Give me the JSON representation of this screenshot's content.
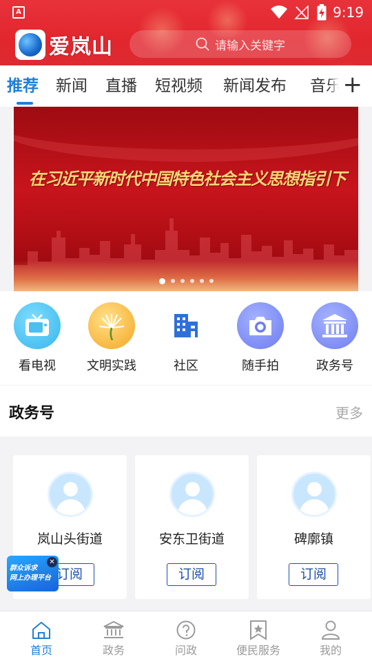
{
  "status_bar": {
    "time": "9:19",
    "app_icon": "A"
  },
  "header": {
    "app_name": "爱岚山",
    "search_placeholder": "请输入关键字"
  },
  "tabs": [
    {
      "label": "推荐",
      "active": true
    },
    {
      "label": "新闻"
    },
    {
      "label": "直播"
    },
    {
      "label": "短视频"
    },
    {
      "label": "新闻发布"
    },
    {
      "label": "音乐"
    }
  ],
  "tab_more": "+",
  "banner": {
    "headline": "在习近平新时代中国特色社会主义思想指引下",
    "slide_count": 6,
    "current_slide": 1
  },
  "quick_links": [
    {
      "label": "看电视",
      "icon": "tv-icon",
      "color": "#35b7ec"
    },
    {
      "label": "文明实践",
      "icon": "sunflower-icon",
      "color": "#f5a623"
    },
    {
      "label": "社区",
      "icon": "building-icon",
      "color": "#2f6fd8"
    },
    {
      "label": "随手拍",
      "icon": "camera-icon",
      "color": "#6d7cf0"
    },
    {
      "label": "政务号",
      "icon": "government-icon",
      "color": "#6f7ff0"
    }
  ],
  "gov_section": {
    "title": "政务号",
    "more": "更多",
    "items": [
      {
        "name": "岚山头街道",
        "subscribe": "订阅"
      },
      {
        "name": "安东卫街道",
        "subscribe": "订阅"
      },
      {
        "name": "碑廓镇",
        "subscribe": "订阅"
      }
    ]
  },
  "floating_badge": {
    "line1": "群众诉求",
    "line2": "网上办理平台"
  },
  "bottom_nav": [
    {
      "label": "首页",
      "icon": "home-icon",
      "active": true
    },
    {
      "label": "政务",
      "icon": "government-icon"
    },
    {
      "label": "问政",
      "icon": "question-icon"
    },
    {
      "label": "便民服务",
      "icon": "bookmark-star-icon"
    },
    {
      "label": "我的",
      "icon": "user-icon"
    }
  ],
  "colors": {
    "header_red": "#e2262e",
    "accent_blue": "#1f7fd9",
    "subscribe_blue": "#1a4fa8"
  }
}
